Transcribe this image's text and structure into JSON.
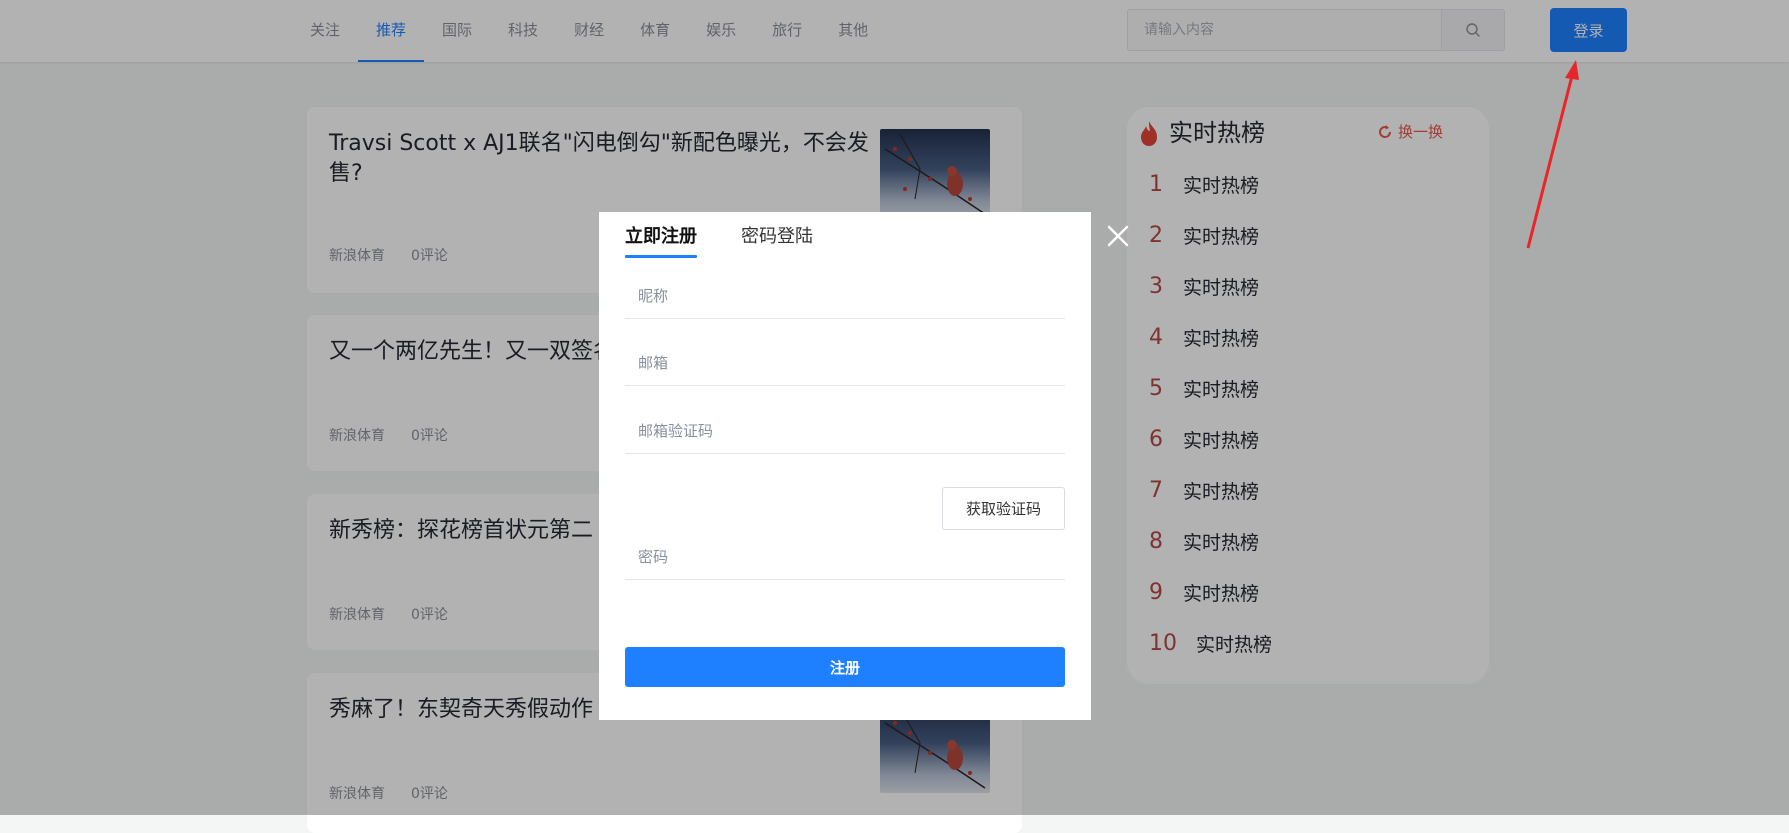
{
  "nav": {
    "items": [
      {
        "label": "关注"
      },
      {
        "label": "推荐"
      },
      {
        "label": "国际"
      },
      {
        "label": "科技"
      },
      {
        "label": "财经"
      },
      {
        "label": "体育"
      },
      {
        "label": "娱乐"
      },
      {
        "label": "旅行"
      },
      {
        "label": "其他"
      }
    ],
    "active_index": 1
  },
  "search": {
    "placeholder": "请输入内容",
    "icon": "search-icon"
  },
  "login_label": "登录",
  "articles": [
    {
      "title": "Travsi Scott x AJ1联名\"闪电倒勾\"新配色曝光，不会发售?",
      "source": "新浪体育",
      "comments": "0评论"
    },
    {
      "title": "又一个两亿先生！又一双签名鞋！",
      "source": "新浪体育",
      "comments": "0评论"
    },
    {
      "title": "新秀榜：探花榜首状元第二",
      "source": "新浪体育",
      "comments": "0评论"
    },
    {
      "title": "秀麻了！东契奇天秀假动作",
      "source": "新浪体育",
      "comments": "0评论"
    }
  ],
  "hot": {
    "title": "实时热榜",
    "refresh": "换一换",
    "items": [
      {
        "rank": "1",
        "label": "实时热榜"
      },
      {
        "rank": "2",
        "label": "实时热榜"
      },
      {
        "rank": "3",
        "label": "实时热榜"
      },
      {
        "rank": "4",
        "label": "实时热榜"
      },
      {
        "rank": "5",
        "label": "实时热榜"
      },
      {
        "rank": "6",
        "label": "实时热榜"
      },
      {
        "rank": "7",
        "label": "实时热榜"
      },
      {
        "rank": "8",
        "label": "实时热榜"
      },
      {
        "rank": "9",
        "label": "实时热榜"
      },
      {
        "rank": "10",
        "label": "实时热榜"
      }
    ]
  },
  "modal": {
    "tabs": [
      {
        "label": "立即注册"
      },
      {
        "label": "密码登陆"
      }
    ],
    "active_tab": 0,
    "nickname_placeholder": "昵称",
    "email_placeholder": "邮箱",
    "email_code_placeholder": "邮箱验证码",
    "get_code_label": "获取验证码",
    "password_placeholder": "密码",
    "submit_label": "注册"
  },
  "colors": {
    "accent": "#1e80ff",
    "hot_rank": "#b54a45",
    "refresh": "#e8564b"
  }
}
